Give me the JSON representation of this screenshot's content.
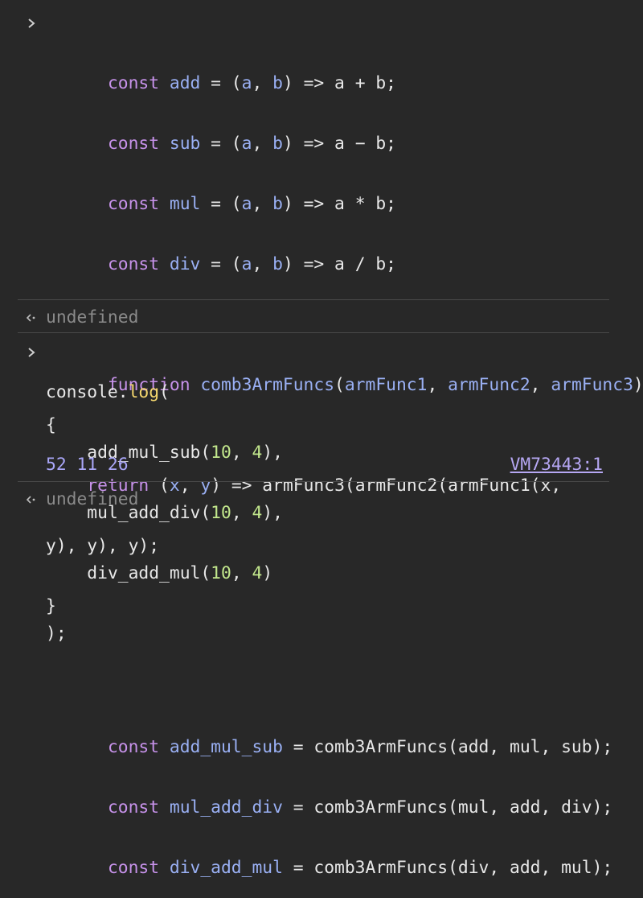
{
  "console": {
    "entry1": {
      "lines": [
        [
          "const",
          " ",
          "add",
          " = (",
          "a",
          ", ",
          "b",
          ") => a + b;"
        ],
        [
          "const",
          " ",
          "sub",
          " = (",
          "a",
          ", ",
          "b",
          ") => a − b;"
        ],
        [
          "const",
          " ",
          "mul",
          " = (",
          "a",
          ", ",
          "b",
          ") => a * b;"
        ],
        [
          "const",
          " ",
          "div",
          " = (",
          "a",
          ", ",
          "b",
          ") => a / b;"
        ]
      ],
      "func_kw": "function",
      "func_name": "comb3ArmFuncs",
      "func_open": "(",
      "param1": "armFunc1",
      "param2": "armFunc2",
      "param3": "armFunc3",
      "func_close": ")",
      "brace_open": "{",
      "return_kw": "return",
      "ret_open": " (",
      "ret_x": "x",
      "ret_comma": ", ",
      "ret_y": "y",
      "ret_rest": ") => armFunc3(armFunc2(armFunc1(x,",
      "ret_cont": "y), y), y);",
      "brace_close": "}",
      "combo_lines": [
        [
          "const",
          " ",
          "add_mul_sub",
          " = comb3ArmFuncs(add, mul, sub);"
        ],
        [
          "const",
          " ",
          "mul_add_div",
          " = comb3ArmFuncs(mul, add, div);"
        ],
        [
          "const",
          " ",
          "div_add_mul",
          " = comb3ArmFuncs(div, add, mul);"
        ]
      ],
      "result": "undefined"
    },
    "entry2": {
      "console_obj": "console.",
      "log": "log",
      "paren_open": "(",
      "calls": [
        {
          "fn": "add_mul_sub",
          "a": "10",
          "b": "4",
          "end": "),"
        },
        {
          "fn": "mul_add_div",
          "a": "10",
          "b": "4",
          "end": "),"
        },
        {
          "fn": "div_add_mul",
          "a": "10",
          "b": "4",
          "end": ")"
        }
      ],
      "close": ");",
      "output": "52 11 26",
      "source_link": "VM73443:1",
      "result": "undefined"
    }
  },
  "icons": {
    "prompt": "chevron-right-icon",
    "return": "return-arrow-icon"
  },
  "colors": {
    "background": "#282828",
    "keyword": "#c792ea",
    "identifier": "#9ab0f4",
    "number": "#c3e88d",
    "method": "#f5d76e",
    "output": "#a9a6f8",
    "dim": "#8a8a8a"
  }
}
